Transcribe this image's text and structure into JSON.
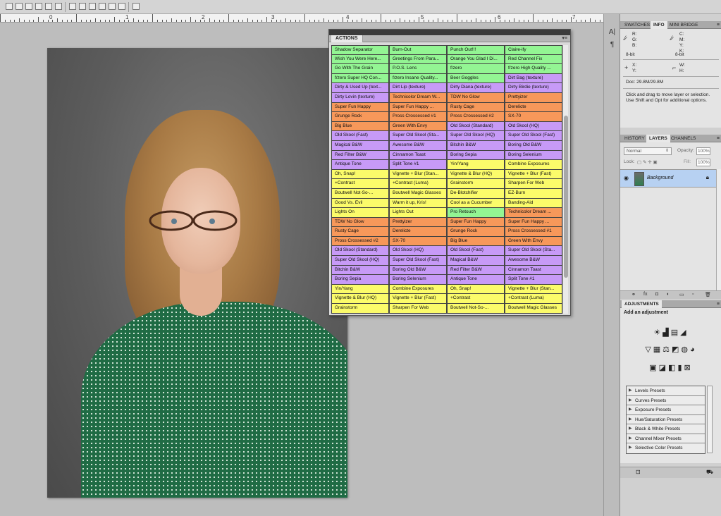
{
  "actions_panel": {
    "tab": "ACTIONS",
    "colors": {
      "green": "#93f593",
      "purple": "#c79af7",
      "orange": "#f7985a",
      "yellow": "#fbfb6a"
    },
    "rows": [
      [
        [
          "Shadow Separator",
          "green"
        ],
        [
          "Burn-Out",
          "green"
        ],
        [
          "Punch Out!!!",
          "green"
        ],
        [
          "Claire-ify",
          "green"
        ]
      ],
      [
        [
          "Wish You Were Here...",
          "green"
        ],
        [
          "Greetings From Para...",
          "green"
        ],
        [
          "Orange You Glad I Di...",
          "green"
        ],
        [
          "Red Channel Fix",
          "green"
        ]
      ],
      [
        [
          "Go With The Grain",
          "green"
        ],
        [
          "P.O.S. Lens",
          "green"
        ],
        [
          "f/zero",
          "green"
        ],
        [
          "f/zero High Quality ...",
          "green"
        ]
      ],
      [
        [
          "f/zero Super HQ Con...",
          "green"
        ],
        [
          "f/zero Insane Quality...",
          "green"
        ],
        [
          "Beer Goggles",
          "green"
        ],
        [
          "Dirt Bag (texture)",
          "purple"
        ]
      ],
      [
        [
          "Dirty & Used Up (text...",
          "purple"
        ],
        [
          "Dirt Lip (texture)",
          "purple"
        ],
        [
          "Dirty Diana (texture)",
          "purple"
        ],
        [
          "Dirty Birdie (texture)",
          "purple"
        ]
      ],
      [
        [
          "Dirty Lovin (texture)",
          "purple"
        ],
        [
          "Technicolor Dream W...",
          "orange"
        ],
        [
          "TDW No Glow",
          "orange"
        ],
        [
          "Prettyizer",
          "orange"
        ]
      ],
      [
        [
          "Super Fun Happy",
          "orange"
        ],
        [
          "Super Fun Happy ...",
          "orange"
        ],
        [
          "Rusty Cage",
          "orange"
        ],
        [
          "Derelicte",
          "orange"
        ]
      ],
      [
        [
          "Grunge Rock",
          "orange"
        ],
        [
          "Pross Crossessed #1",
          "orange"
        ],
        [
          "Pross Crossessed #2",
          "orange"
        ],
        [
          "SX-70",
          "orange"
        ]
      ],
      [
        [
          "Big Blue",
          "orange"
        ],
        [
          "Green With Envy",
          "orange"
        ],
        [
          "Old Skool (Standard)",
          "purple"
        ],
        [
          "Old Skool (HQ)",
          "purple"
        ]
      ],
      [
        [
          "Old Skool (Fast)",
          "purple"
        ],
        [
          "Super Old Skool (Sta...",
          "purple"
        ],
        [
          "Super Old Skool (HQ)",
          "purple"
        ],
        [
          "Super Old Skool (Fast)",
          "purple"
        ]
      ],
      [
        [
          "Magical B&W",
          "purple"
        ],
        [
          "Awesome B&W",
          "purple"
        ],
        [
          "Bitchin B&W",
          "purple"
        ],
        [
          "Boring Old B&W",
          "purple"
        ]
      ],
      [
        [
          "Red Filter B&W",
          "purple"
        ],
        [
          "Cinnamon Toast",
          "purple"
        ],
        [
          "Boring Sepia",
          "purple"
        ],
        [
          "Boring Selenium",
          "purple"
        ]
      ],
      [
        [
          "Antique Tone",
          "purple"
        ],
        [
          "Split Tone #1",
          "purple"
        ],
        [
          "Yin/Yang",
          "yellow"
        ],
        [
          "Combine Exposures",
          "yellow"
        ]
      ],
      [
        [
          "Oh, Snap!",
          "yellow"
        ],
        [
          "Vignette + Blur (Stan...",
          "yellow"
        ],
        [
          "Vignette & Blur (HQ)",
          "yellow"
        ],
        [
          "Vignette + Blur (Fast)",
          "yellow"
        ]
      ],
      [
        [
          "+Contrast",
          "yellow"
        ],
        [
          "+Contrast (Luma)",
          "yellow"
        ],
        [
          "Grainstorm",
          "yellow"
        ],
        [
          "Sharpen For Web",
          "yellow"
        ]
      ],
      [
        [
          "Boutwell Not-So-...",
          "yellow"
        ],
        [
          "Boutwell Magic Glasses",
          "yellow"
        ],
        [
          "De-Blotchifier",
          "yellow"
        ],
        [
          "EZ-Burn",
          "yellow"
        ]
      ],
      [
        [
          "Good Vs. Evil",
          "yellow"
        ],
        [
          "Warm it up, Kris!",
          "yellow"
        ],
        [
          "Cool as a Cucumber",
          "yellow"
        ],
        [
          "Banding-Aid",
          "yellow"
        ]
      ],
      [
        [
          "Lights On",
          "yellow"
        ],
        [
          "Lights Out",
          "yellow"
        ],
        [
          "Pro Retouch",
          "green"
        ],
        [
          "Technicolor Dream ...",
          "orange"
        ]
      ],
      [
        [
          "TDW No Glow",
          "orange"
        ],
        [
          "Prettyizer",
          "orange"
        ],
        [
          "Super Fun Happy",
          "orange"
        ],
        [
          "Super Fun Happy ...",
          "orange"
        ]
      ],
      [
        [
          "Rusty Cage",
          "orange"
        ],
        [
          "Derelicte",
          "orange"
        ],
        [
          "Grunge Rock",
          "orange"
        ],
        [
          "Pross Crossessed #1",
          "orange"
        ]
      ],
      [
        [
          "Pross Crossessed #2",
          "orange"
        ],
        [
          "SX-70",
          "orange"
        ],
        [
          "Big Blue",
          "orange"
        ],
        [
          "Green With Envy",
          "orange"
        ]
      ],
      [
        [
          "Old Skool (Standard)",
          "purple"
        ],
        [
          "Old Skool (HQ)",
          "purple"
        ],
        [
          "Old Skool (Fast)",
          "purple"
        ],
        [
          "Super Old Skool (Sta...",
          "purple"
        ]
      ],
      [
        [
          "Super Old Skool (HQ)",
          "purple"
        ],
        [
          "Super Old Skool (Fast)",
          "purple"
        ],
        [
          "Magical B&W",
          "purple"
        ],
        [
          "Awesome B&W",
          "purple"
        ]
      ],
      [
        [
          "Bitchin B&W",
          "purple"
        ],
        [
          "Boring Old B&W",
          "purple"
        ],
        [
          "Red Filter B&W",
          "purple"
        ],
        [
          "Cinnamon Toast",
          "purple"
        ]
      ],
      [
        [
          "Boring Sepia",
          "purple"
        ],
        [
          "Boring Selenium",
          "purple"
        ],
        [
          "Antique Tone",
          "purple"
        ],
        [
          "Split Tone #1",
          "purple"
        ]
      ],
      [
        [
          "Yin/Yang",
          "yellow"
        ],
        [
          "Combine Exposures",
          "yellow"
        ],
        [
          "Oh, Snap!",
          "yellow"
        ],
        [
          "Vignette + Blur (Stan...",
          "yellow"
        ]
      ],
      [
        [
          "Vignette & Blur (HQ)",
          "yellow"
        ],
        [
          "Vignette + Blur (Fast)",
          "yellow"
        ],
        [
          "+Contrast",
          "yellow"
        ],
        [
          "+Contrast (Luma)",
          "yellow"
        ]
      ],
      [
        [
          "Grainstorm",
          "yellow"
        ],
        [
          "Sharpen For Web",
          "yellow"
        ],
        [
          "Boutwell Not-So-...",
          "yellow"
        ],
        [
          "Boutwell Magic Glasses",
          "yellow"
        ]
      ]
    ]
  },
  "ruler": {
    "numbers": [
      "0",
      "1",
      "2",
      "3",
      "4",
      "5",
      "6",
      "7"
    ]
  },
  "info_panel": {
    "tabs": [
      "SWATCHES",
      "INFO",
      "MINI BRIDGE"
    ],
    "active_tab": "INFO",
    "rgb": [
      "R:",
      "G:",
      "B:"
    ],
    "cmyk": [
      "C:",
      "M:",
      "Y:",
      "K:"
    ],
    "bit_left": "8-bit",
    "bit_right": "8-bit",
    "xy": [
      "X:",
      "Y:"
    ],
    "wh": [
      "W:",
      "H:"
    ],
    "doc": "Doc: 29.8M/29.8M",
    "hint1": "Click and drag to move layer or selection.",
    "hint2": "Use Shift and Opt for additional options."
  },
  "layers_panel": {
    "tabs": [
      "HISTORY",
      "LAYERS",
      "CHANNELS"
    ],
    "active_tab": "LAYERS",
    "blend_mode": "Normal",
    "opacity_label": "Opacity:",
    "opacity": "100%",
    "lock_label": "Lock:",
    "fill_label": "Fill:",
    "fill": "100%",
    "layer_name": "Background"
  },
  "adjustments_panel": {
    "tab": "ADJUSTMENTS",
    "heading": "Add an adjustment",
    "presets": [
      "Levels Presets",
      "Curves Presets",
      "Exposure Presets",
      "Hue/Saturation Presets",
      "Black & White Presets",
      "Channel Mixer Presets",
      "Selective Color Presets"
    ]
  }
}
